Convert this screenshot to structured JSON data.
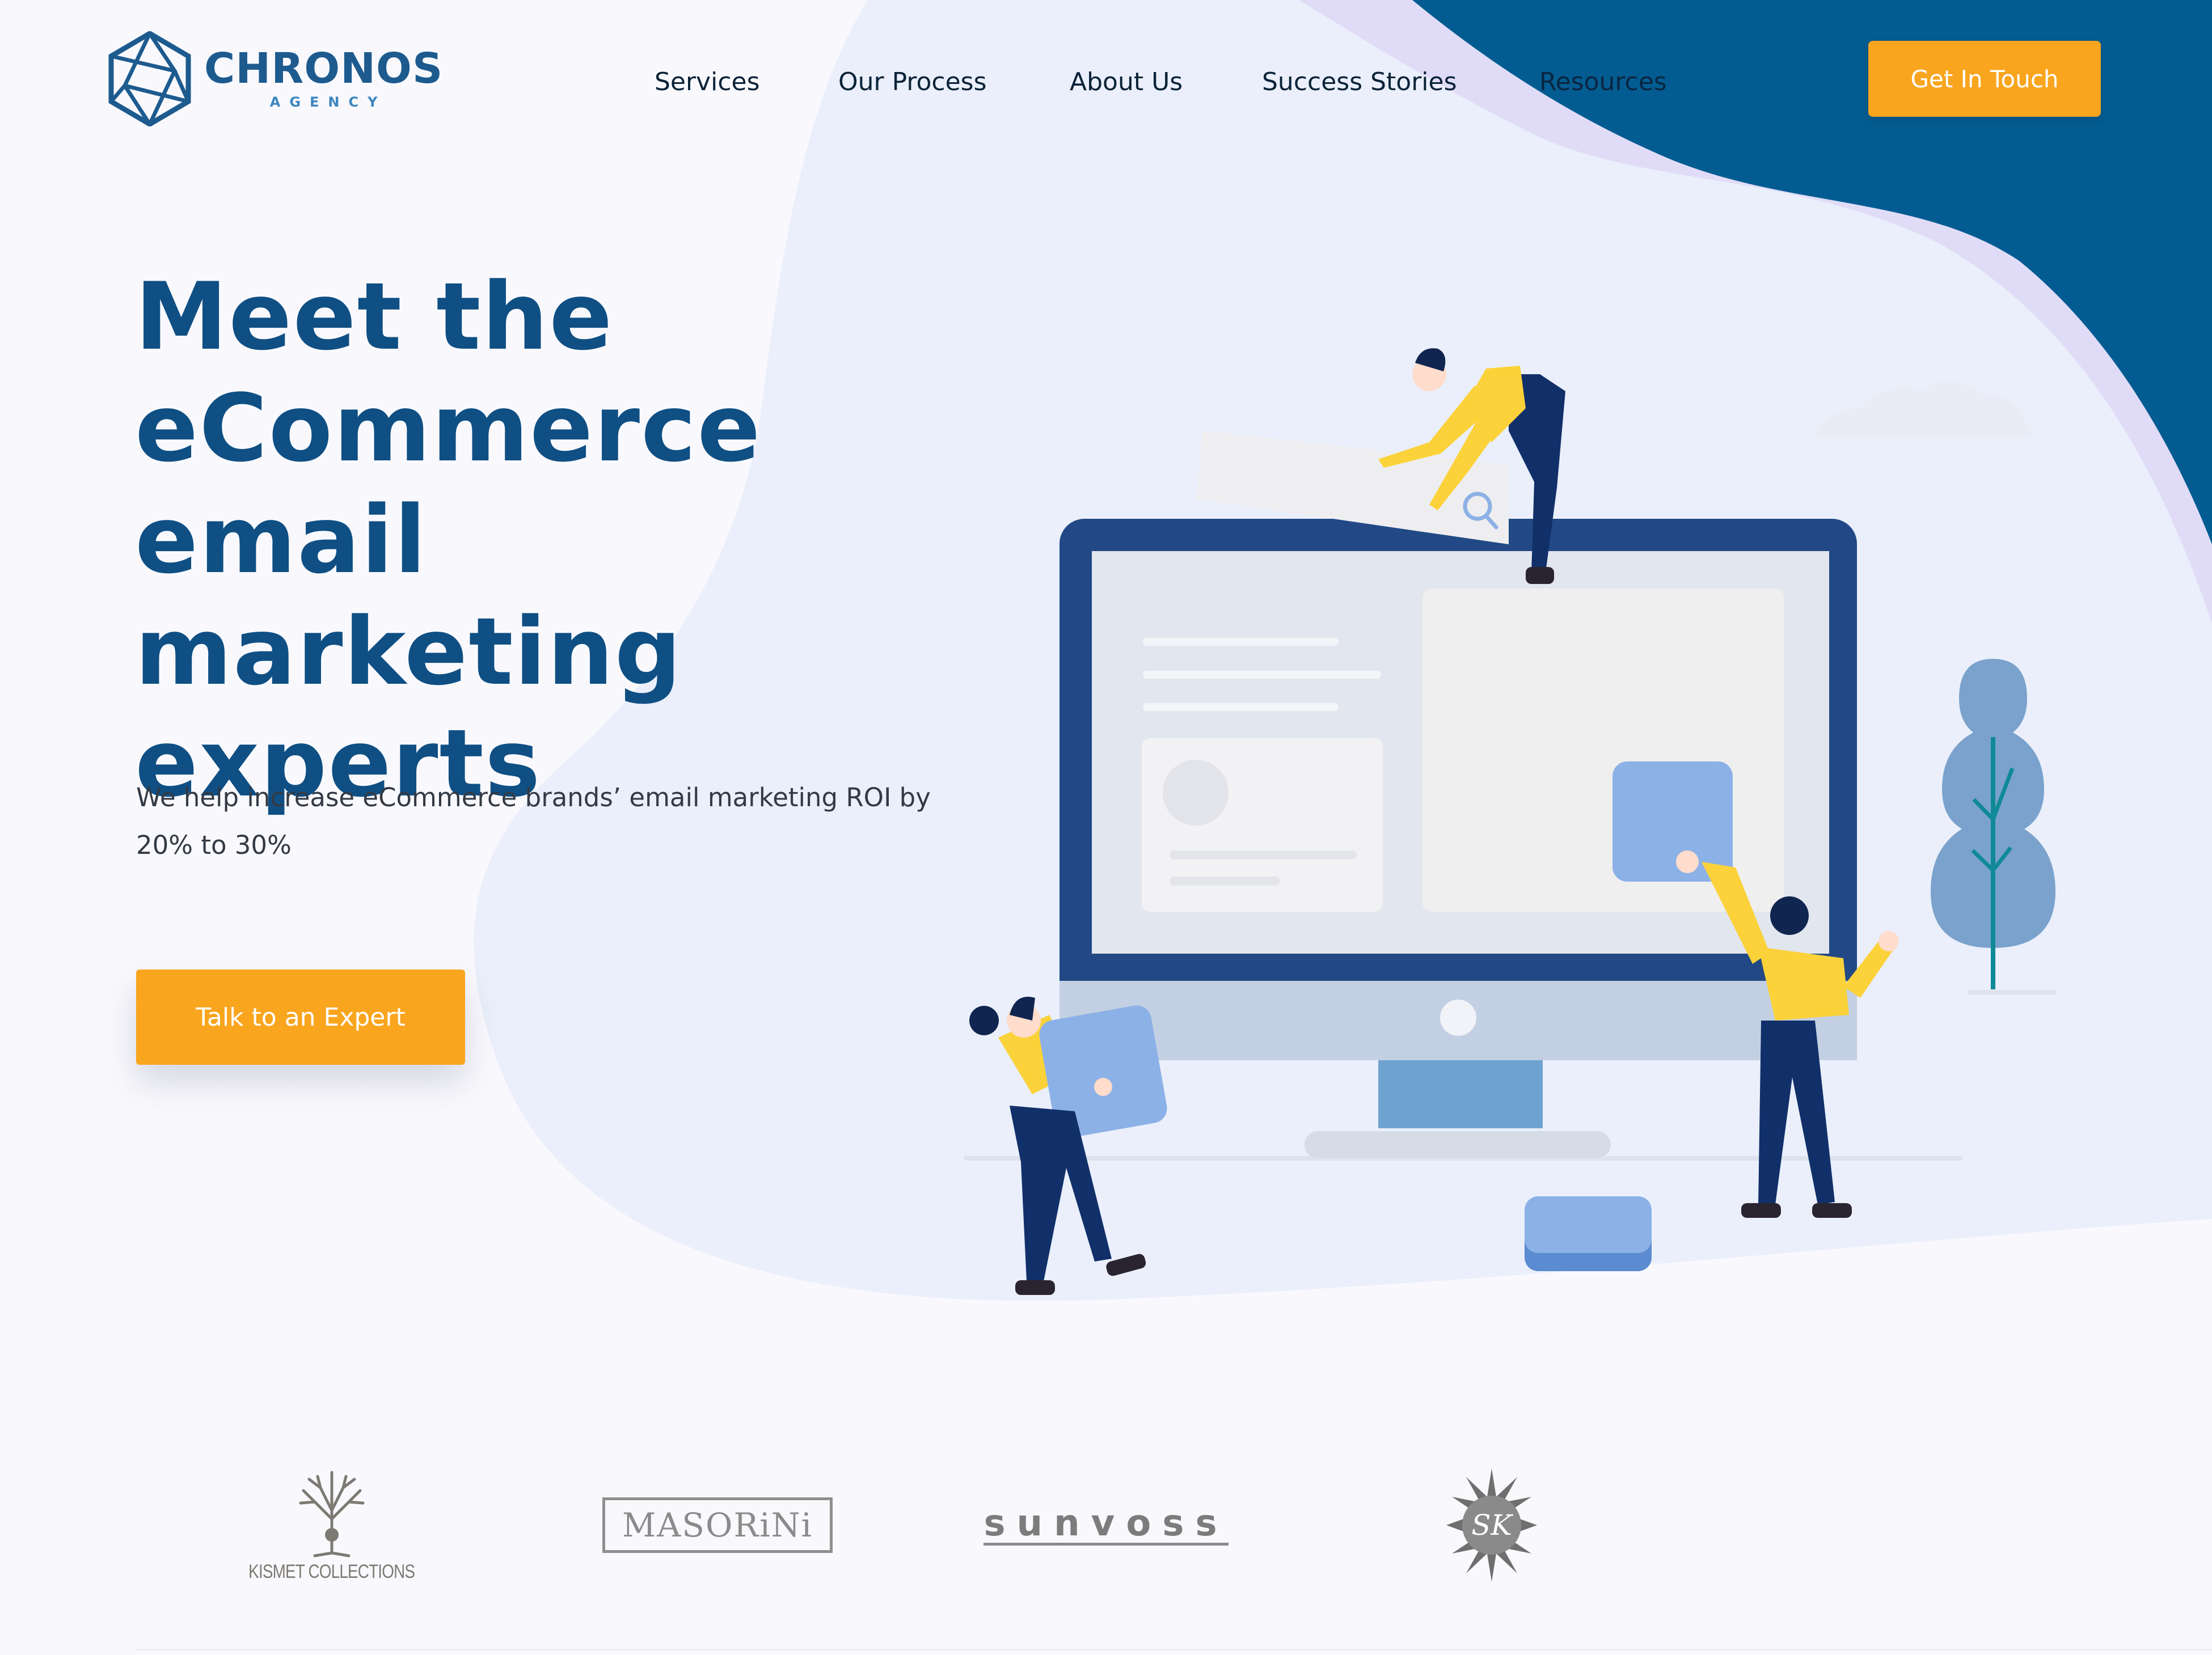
{
  "brand": {
    "name": "CHRONOS",
    "tagline": "AGENCY",
    "logo_icon": "hexagon-logo-icon",
    "primary_color": "#0f4f84",
    "accent_color": "#f9a51e"
  },
  "nav": {
    "items": [
      {
        "label": "Services"
      },
      {
        "label": "Our Process"
      },
      {
        "label": "About Us"
      },
      {
        "label": "Success Stories"
      },
      {
        "label": "Resources"
      }
    ],
    "cta_label": "Get In Touch"
  },
  "hero": {
    "title_lines": [
      "Meet the",
      "eCommerce",
      "email marketing",
      "experts"
    ],
    "subtitle_line1": "We help increase eCommerce brands’ email marketing ROI by",
    "subtitle_line2": "20% to 30%",
    "cta_label": "Talk to an Expert"
  },
  "clients": {
    "kismet": "KISMET COLLECTIONS",
    "masorini": "MASORiNi",
    "sunvoss": "sunvoss",
    "sk": "SK"
  }
}
